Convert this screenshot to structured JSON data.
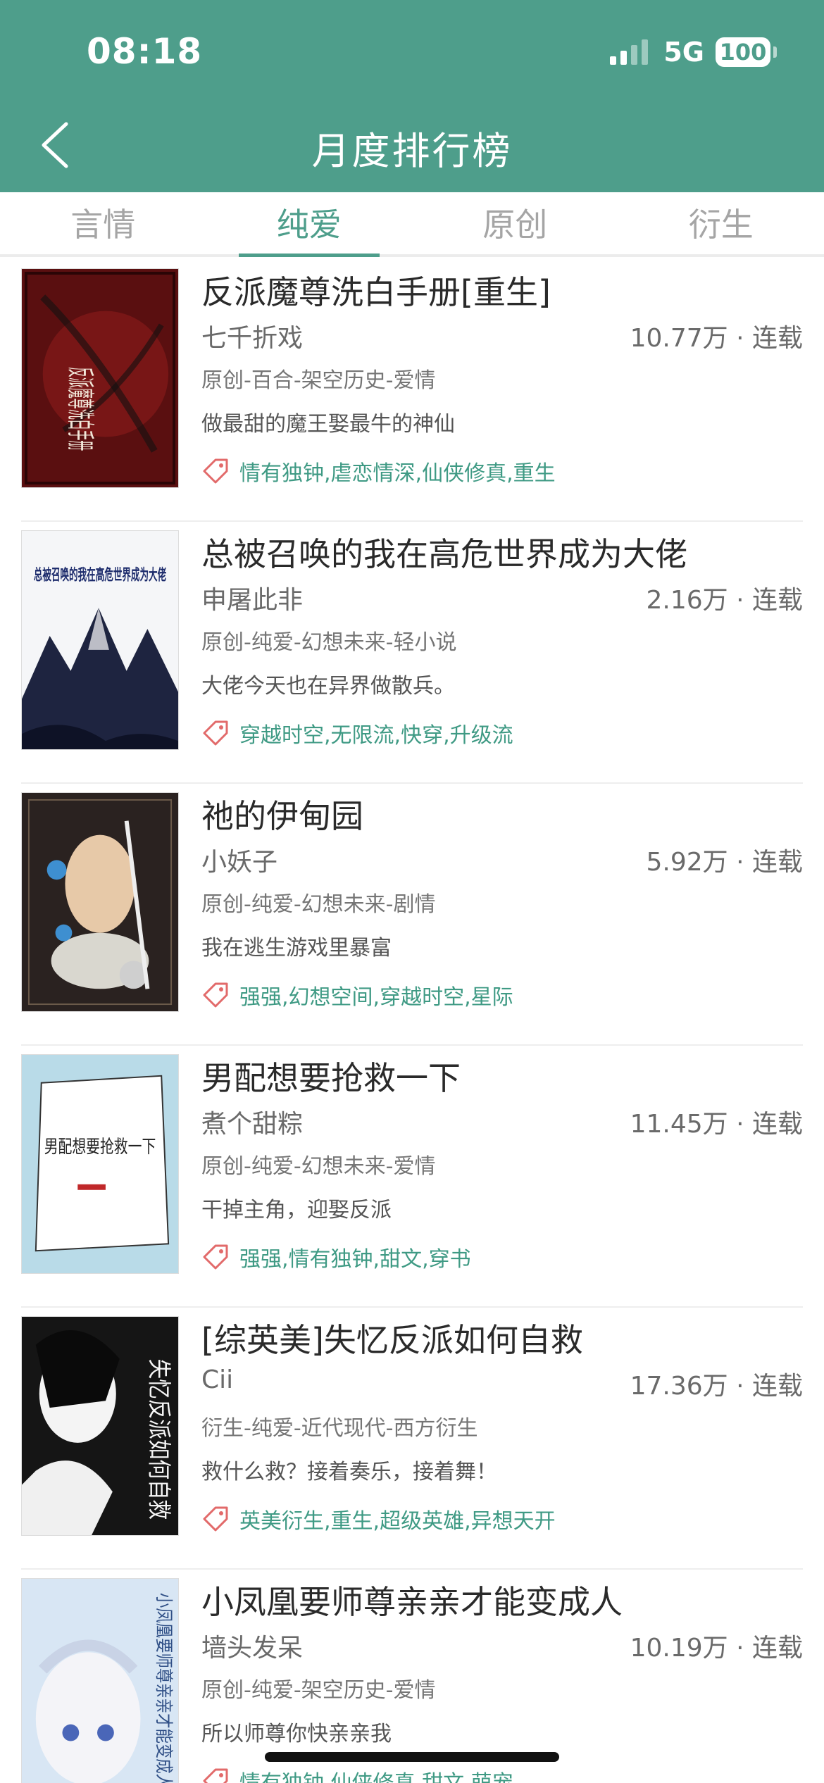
{
  "status_bar": {
    "time": "08:18",
    "network": "5G",
    "battery": "100"
  },
  "header": {
    "title": "月度排行榜"
  },
  "tabs": [
    {
      "label": "言情",
      "active": false
    },
    {
      "label": "纯爱",
      "active": true
    },
    {
      "label": "原创",
      "active": false
    },
    {
      "label": "衍生",
      "active": false
    }
  ],
  "books": [
    {
      "title": "反派魔尊洗白手册[重生]",
      "author": "七千折戏",
      "stats": "10.77万 · 连载",
      "genre": "原创-百合-架空历史-爱情",
      "desc": "做最甜的魔王娶最牛的神仙",
      "tags": "情有独钟,虐恋情深,仙侠修真,重生",
      "cover_text": "反派魔尊洗白手册"
    },
    {
      "title": "总被召唤的我在高危世界成为大佬",
      "author": "申屠此非",
      "stats": "2.16万 · 连载",
      "genre": "原创-纯爱-幻想未来-轻小说",
      "desc": "大佬今天也在异界做散兵。",
      "tags": "穿越时空,无限流,快穿,升级流",
      "cover_text": "总被召唤的我在高危世界成为大佬"
    },
    {
      "title": "祂的伊甸园",
      "author": "小妖子",
      "stats": "5.92万 · 连载",
      "genre": "原创-纯爱-幻想未来-剧情",
      "desc": "我在逃生游戏里暴富",
      "tags": "强强,幻想空间,穿越时空,星际",
      "cover_text": ""
    },
    {
      "title": "男配想要抢救一下",
      "author": "煮个甜粽",
      "stats": "11.45万 · 连载",
      "genre": "原创-纯爱-幻想未来-爱情",
      "desc": "干掉主角，迎娶反派",
      "tags": "强强,情有独钟,甜文,穿书",
      "cover_text": "男配想要抢救一下"
    },
    {
      "title": "[综英美]失忆反派如何自救",
      "author": "Cii",
      "stats": "17.36万 · 连载",
      "genre": "衍生-纯爱-近代现代-西方衍生",
      "desc": "救什么救？接着奏乐，接着舞！",
      "tags": "英美衍生,重生,超级英雄,异想天开",
      "cover_text": "失忆反派如何自救"
    },
    {
      "title": "小凤凰要师尊亲亲才能变成人",
      "author": "墙头发呆",
      "stats": "10.19万 · 连载",
      "genre": "原创-纯爱-架空历史-爱情",
      "desc": "所以师尊你快亲亲我",
      "tags": "情有独钟,仙侠修真,甜文,萌宠",
      "cover_text": "小凤凰要师尊亲亲才能变成人"
    }
  ],
  "colors": {
    "brand": "#4e9e8b",
    "tag": "#3f9a84",
    "tag_icon": "#e26a6a"
  }
}
